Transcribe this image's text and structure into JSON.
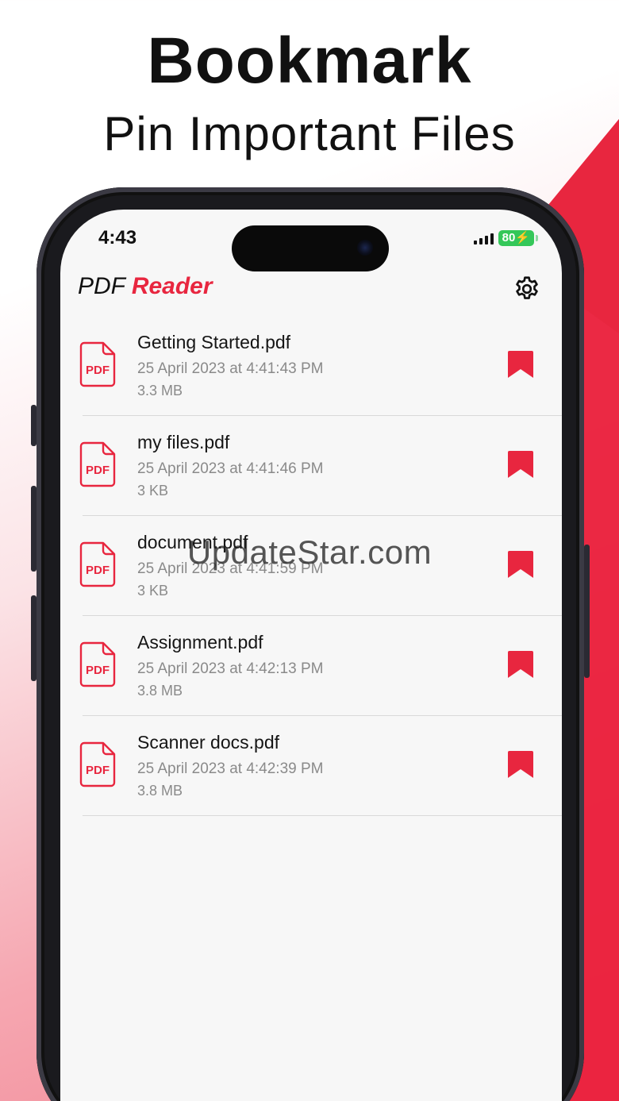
{
  "headline": {
    "title": "Bookmark",
    "subtitle": "Pin Important Files"
  },
  "status_bar": {
    "time": "4:43",
    "battery": "80"
  },
  "app": {
    "title_prefix": "PDF",
    "title_accent": "Reader",
    "settings_icon": "gear-icon"
  },
  "files": [
    {
      "name": "Getting Started.pdf",
      "date": "25 April 2023 at 4:41:43 PM",
      "size": "3.3 MB",
      "bookmarked": true,
      "icon_label": "PDF"
    },
    {
      "name": "my files.pdf",
      "date": "25 April 2023 at 4:41:46 PM",
      "size": "3 KB",
      "bookmarked": true,
      "icon_label": "PDF"
    },
    {
      "name": "document.pdf",
      "date": "25 April 2023 at 4:41:59 PM",
      "size": "3 KB",
      "bookmarked": true,
      "icon_label": "PDF"
    },
    {
      "name": "Assignment.pdf",
      "date": "25 April 2023 at 4:42:13 PM",
      "size": "3.8 MB",
      "bookmarked": true,
      "icon_label": "PDF"
    },
    {
      "name": "Scanner docs.pdf",
      "date": "25 April 2023 at 4:42:39 PM",
      "size": "3.8 MB",
      "bookmarked": true,
      "icon_label": "PDF"
    }
  ],
  "watermark": "UpdateStar.com",
  "colors": {
    "accent": "#e8263f",
    "battery": "#34c759"
  }
}
